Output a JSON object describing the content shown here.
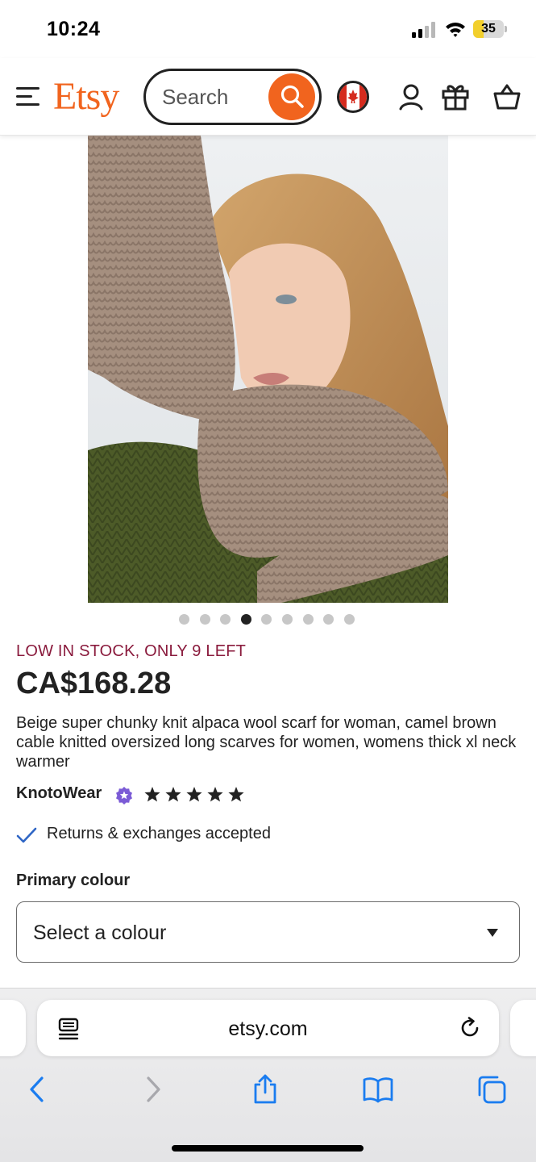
{
  "status_bar": {
    "time": "10:24",
    "battery": "35",
    "battery_level": 0.35
  },
  "header": {
    "logo": "Etsy",
    "search_placeholder": "Search",
    "icons": [
      "menu-icon",
      "search-icon",
      "canada-flag-icon",
      "account-icon",
      "gift-icon",
      "basket-icon"
    ]
  },
  "gallery": {
    "image_count": 9,
    "active_index": 3
  },
  "product": {
    "stock": "LOW IN STOCK, ONLY 9 LEFT",
    "price": "CA$168.28",
    "title": "Beige super chunky knit alpaca wool scarf for woman, camel brown cable knitted oversized long scarves for women, womens thick xl neck warmer",
    "shop_name": "KnotoWear",
    "rating_stars": 5,
    "returns": "Returns & exchanges accepted",
    "colour_label": "Primary colour",
    "colour_select": "Select a colour"
  },
  "browser": {
    "url": "etsy.com",
    "toolbar_icons": [
      "back-icon",
      "forward-icon",
      "share-icon",
      "bookmarks-icon",
      "tabs-icon"
    ]
  },
  "colors": {
    "brand": "#f1641e",
    "stock": "#8a1b3d",
    "safari_blue": "#1a7cf0",
    "star_seller": "#7b5bd6"
  }
}
